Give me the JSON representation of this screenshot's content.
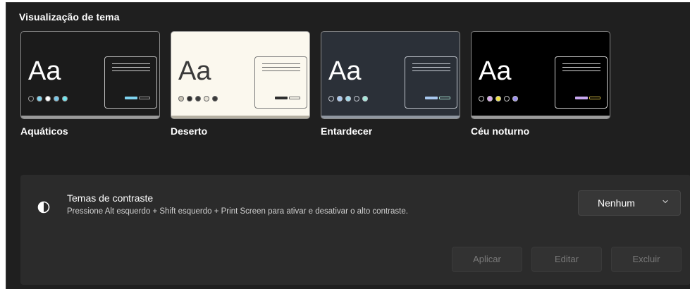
{
  "section": {
    "title": "Visualização de tema"
  },
  "themes": [
    {
      "name": "Aquáticos",
      "sample": "Aa",
      "bg": "#1b1b1b",
      "text_color": "#ffffff",
      "window_border": "#bfbfbf",
      "line_color": "#cfcfcf",
      "baseline": "#9a9a9a",
      "dots": [
        "#1b1b1b",
        "#7fd4f0",
        "#ffffff",
        "#77c7e8",
        "#6ee6f0"
      ],
      "dot_outline": "#9a9a9a",
      "btn_fill": "#7fd4f0",
      "btn_outline": "#9a9a9a"
    },
    {
      "name": "Deserto",
      "sample": "Aa",
      "bg": "#fbf8ee",
      "text_color": "#3a3a3a",
      "window_border": "#7a7a7a",
      "line_color": "#6a6a6a",
      "baseline": "#b5b0a2",
      "dots": [
        "#c9c4b6",
        "#2e2e2e",
        "#3d3d3d",
        "#e8e4d8",
        "#3a3a3a"
      ],
      "dot_outline": "#6a6a6a",
      "btn_fill": "#2e2e2e",
      "btn_outline": "#6a6a6a"
    },
    {
      "name": "Entardecer",
      "sample": "Aa",
      "bg": "#2b3038",
      "text_color": "#ffffff",
      "window_border": "#bfc4cc",
      "line_color": "#c9ced6",
      "baseline": "#8f96a0",
      "dots": [
        "#2b3038",
        "#a8c8f0",
        "#9fd8e8",
        "#2b3038",
        "#a2e8d8"
      ],
      "dot_outline": "#bfc4cc",
      "btn_fill": "#a8c8f0",
      "btn_outline": "#9fd8c8"
    },
    {
      "name": "Céu noturno",
      "sample": "Aa",
      "bg": "#000000",
      "text_color": "#ffffff",
      "window_border": "#d0d0d0",
      "line_color": "#d8d8d8",
      "baseline": "#9a9a9a",
      "dots": [
        "#000000",
        "#d9a8f0",
        "#f0e040",
        "#000000",
        "#9a8ef0"
      ],
      "dot_outline": "#bfbfbf",
      "btn_fill": "#c8a8f0",
      "btn_outline": "#c8b040"
    }
  ],
  "contrast": {
    "icon": "contrast-icon",
    "title": "Temas de contraste",
    "description": "Pressione Alt esquerdo + Shift esquerdo + Print Screen para ativar e desativar o alto contraste.",
    "dropdown_value": "Nenhum"
  },
  "actions": {
    "apply": "Aplicar",
    "edit": "Editar",
    "delete": "Excluir"
  }
}
